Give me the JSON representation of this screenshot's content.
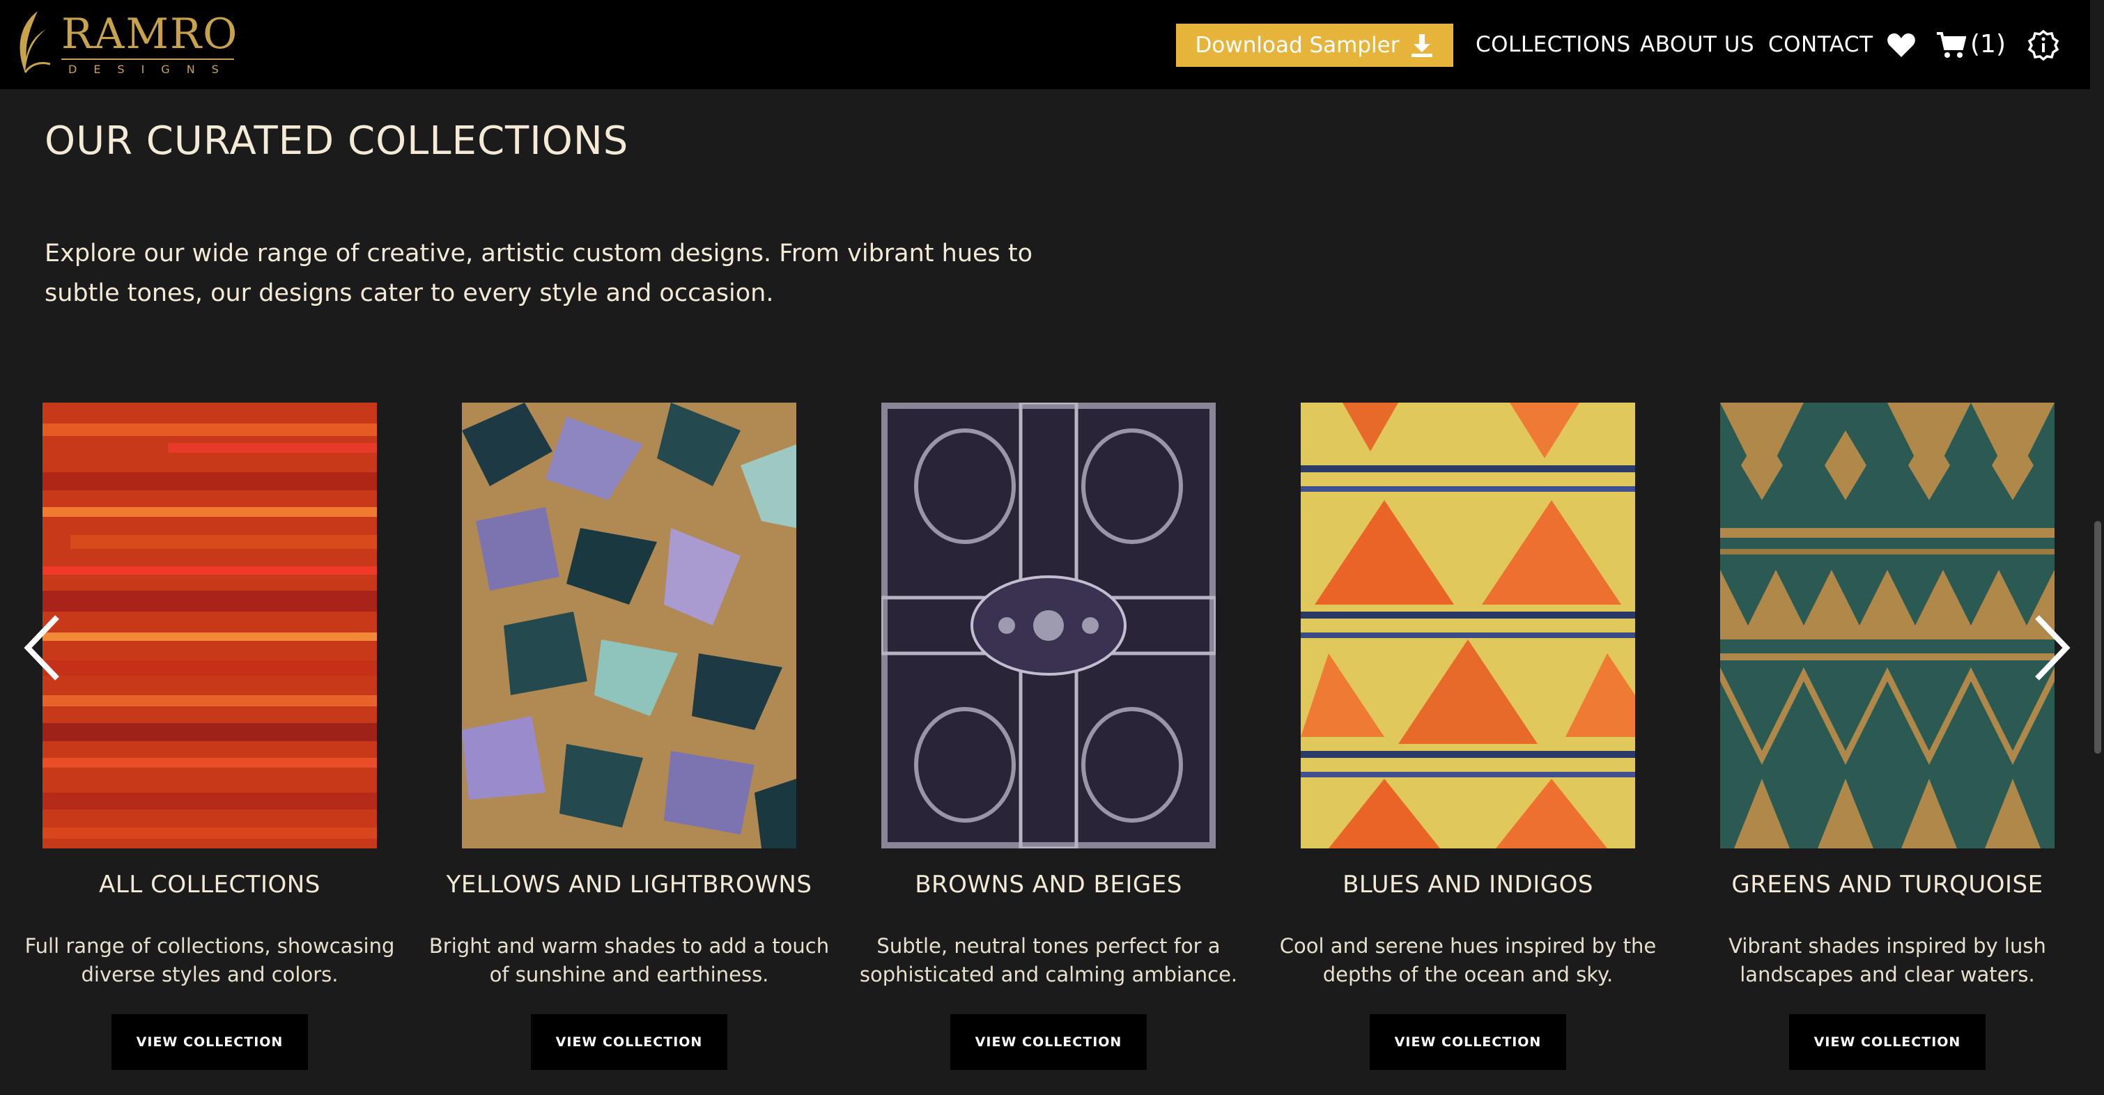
{
  "brand": {
    "name": "RAMRO",
    "tagline": "DESIGNS",
    "accent_color": "#e6b43a",
    "logo_color": "#c9a34a"
  },
  "nav": {
    "sampler_label": "Download Sampler",
    "links": [
      "COLLECTIONS",
      "ABOUT US",
      "CONTACT"
    ],
    "cart_count": "(1)",
    "icons": [
      "heart-icon",
      "cart-icon",
      "info-icon",
      "download-icon"
    ]
  },
  "section": {
    "title": "OUR CURATED COLLECTIONS",
    "intro_line1": "Explore our wide range of creative, artistic custom designs. From vibrant hues to",
    "intro_line2": "subtle tones, our designs cater to every style and occasion."
  },
  "collections": [
    {
      "title": "ALL COLLECTIONS",
      "desc_line1": "Full range of collections, showcasing",
      "desc_line2": "diverse styles and colors.",
      "button": "VIEW COLLECTION",
      "swatch": "red-orange streaks"
    },
    {
      "title": "YELLOWS AND LIGHTBROWNS",
      "desc_line1": "Bright and warm shades to add a touch",
      "desc_line2": "of sunshine and earthiness.",
      "button": "VIEW COLLECTION",
      "swatch": "tan and lavender abstract"
    },
    {
      "title": "BROWNS AND BEIGES",
      "desc_line1": "Subtle, neutral tones perfect for a",
      "desc_line2": "sophisticated and calming ambiance.",
      "button": "VIEW COLLECTION",
      "swatch": "dark purple damask"
    },
    {
      "title": "BLUES AND INDIGOS",
      "desc_line1": "Cool and serene hues inspired by the",
      "desc_line2": "depths of the ocean and sky.",
      "button": "VIEW COLLECTION",
      "swatch": "yellow orange navy waves"
    },
    {
      "title": "GREENS AND TURQUOISE",
      "desc_line1": "Vibrant shades inspired by lush",
      "desc_line2": "landscapes and clear waters.",
      "button": "VIEW COLLECTION",
      "swatch": "teal and ochre tribal"
    }
  ],
  "carousel": {
    "prev_icon": "chevron-left-icon",
    "next_icon": "chevron-right-icon"
  }
}
